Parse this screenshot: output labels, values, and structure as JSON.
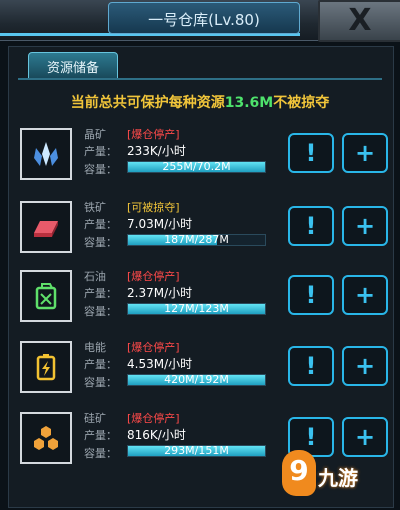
{
  "window": {
    "title": "一号仓库(Lv.80)",
    "close_label": "X"
  },
  "tab": {
    "label": "资源储备"
  },
  "notice": {
    "prefix": "当前总共可保护每种资源",
    "amount": "13.6M",
    "suffix": "不被掠夺"
  },
  "labels": {
    "production": "产量：",
    "capacity": "容量："
  },
  "resources": [
    {
      "name": "晶矿",
      "status": "[爆仓停产]",
      "status_type": "full",
      "rate": "233K/小时",
      "capacity_text": "255M/70.2M",
      "fill": 1.0,
      "icon": "crystal-icon",
      "info_label": "!",
      "add_label": "+"
    },
    {
      "name": "铁矿",
      "status": "[可被掠夺]",
      "status_type": "lootable",
      "rate": "7.03M/小时",
      "capacity_text": "187M/287M",
      "fill": 0.65,
      "icon": "iron-ingot-icon",
      "info_label": "!",
      "add_label": "+"
    },
    {
      "name": "石油",
      "status": "[爆仓停产]",
      "status_type": "full",
      "rate": "2.37M/小时",
      "capacity_text": "127M/123M",
      "fill": 1.0,
      "icon": "oil-can-icon",
      "info_label": "!",
      "add_label": "+"
    },
    {
      "name": "电能",
      "status": "[爆仓停产]",
      "status_type": "full",
      "rate": "4.53M/小时",
      "capacity_text": "420M/192M",
      "fill": 1.0,
      "icon": "battery-icon",
      "info_label": "!",
      "add_label": "+"
    },
    {
      "name": "硅矿",
      "status": "[爆仓停产]",
      "status_type": "full",
      "rate": "816K/小时",
      "capacity_text": "293M/151M",
      "fill": 1.0,
      "icon": "silicon-hex-icon",
      "info_label": "!",
      "add_label": "+"
    }
  ],
  "watermark": {
    "logo": "9",
    "brand": "九游"
  },
  "colors": {
    "accent": "#29b6e8",
    "warning": "#ff4a4a",
    "gold": "#f1c53a",
    "highlight": "#4ee26c"
  }
}
